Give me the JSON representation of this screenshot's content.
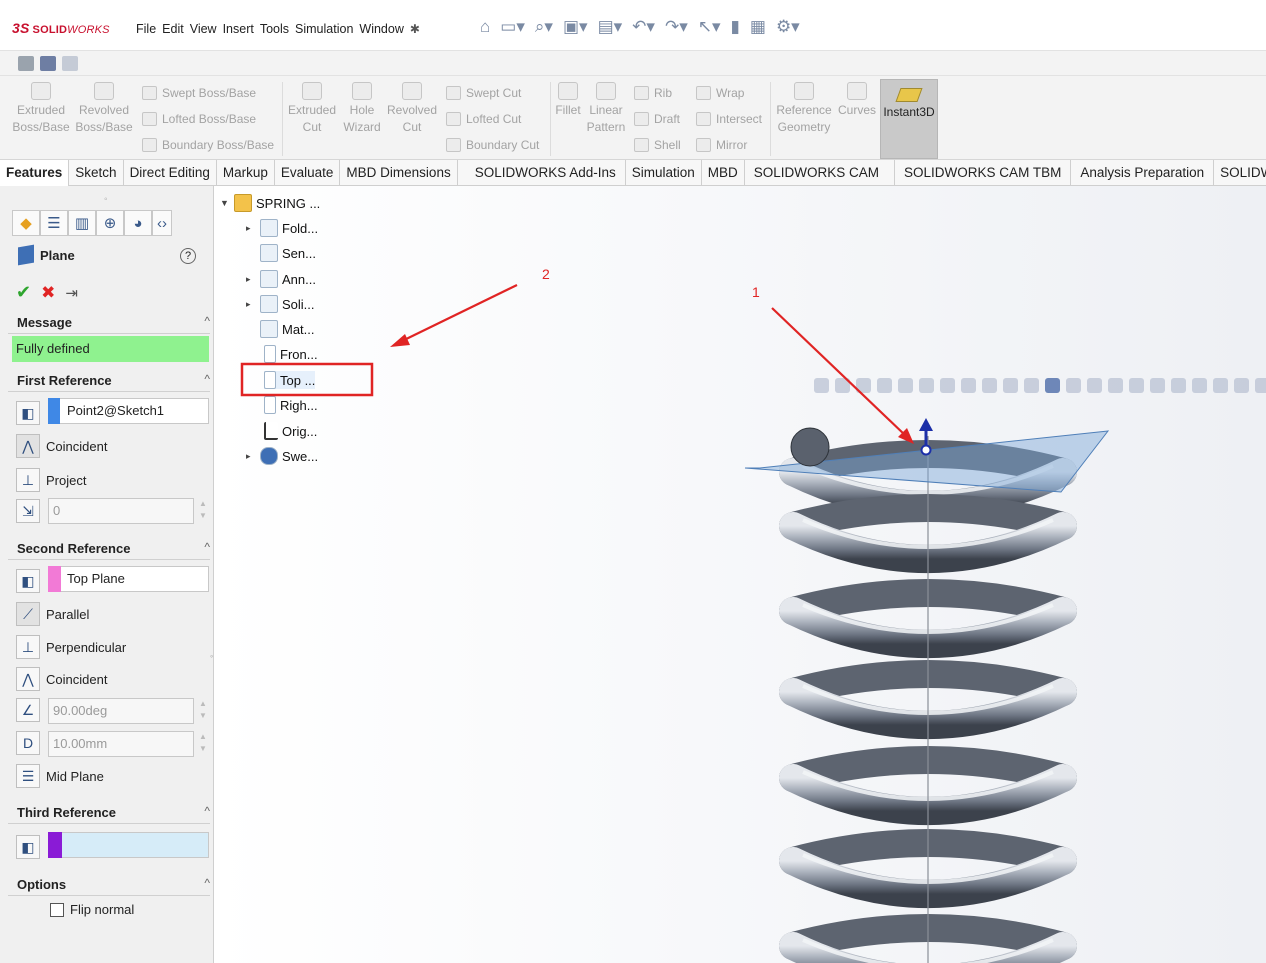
{
  "app": {
    "logo_prefix": "3S",
    "logo_solid": "SOLID",
    "logo_works": "WORKS",
    "menu": [
      "File",
      "Edit",
      "View",
      "Insert",
      "Tools",
      "Simulation",
      "Window"
    ],
    "pin_glyph": "✱"
  },
  "ribbon": {
    "extruded_boss": "Extruded Boss/Base",
    "revolved_boss": "Revolved Boss/Base",
    "swept_boss": "Swept Boss/Base",
    "lofted_boss": "Lofted Boss/Base",
    "boundary_boss": "Boundary Boss/Base",
    "extruded_cut": "Extruded Cut",
    "hole_wizard": "Hole Wizard",
    "revolved_cut": "Revolved Cut",
    "swept_cut": "Swept Cut",
    "lofted_cut": "Lofted Cut",
    "boundary_cut": "Boundary Cut",
    "fillet": "Fillet",
    "linear_pattern": "Linear Pattern",
    "rib": "Rib",
    "wrap": "Wrap",
    "draft": "Draft",
    "intersect": "Intersect",
    "shell": "Shell",
    "mirror": "Mirror",
    "reference_geometry": "Reference Geometry",
    "curves": "Curves",
    "instant3d": "Instant3D"
  },
  "tabs": [
    "Features",
    "Sketch",
    "Direct Editing",
    "Markup",
    "Evaluate",
    "MBD Dimensions",
    "SOLIDWORKS Add-Ins",
    "Simulation",
    "MBD",
    "SOLIDWORKS CAM",
    "SOLIDWORKS CAM TBM",
    "Analysis Preparation",
    "SOLIDW"
  ],
  "pm": {
    "title": "Plane",
    "help_glyph": "?",
    "ok_glyph": "✔",
    "cancel_glyph": "✖",
    "pin_glyph": "⇥",
    "message_head": "Message",
    "message_text": "Fully defined",
    "first_ref_head": "First Reference",
    "first_ref_value": "Point2@Sketch1",
    "coincident": "Coincident",
    "project": "Project",
    "first_value": "0",
    "second_ref_head": "Second Reference",
    "second_ref_value": "Top Plane",
    "parallel": "Parallel",
    "perpendicular": "Perpendicular",
    "coincident2": "Coincident",
    "angle_value": "90.00deg",
    "distance_value": "10.00mm",
    "mid_plane": "Mid Plane",
    "third_ref_head": "Third Reference",
    "options_head": "Options",
    "flip_normal": "Flip normal",
    "collapse_glyph": "^",
    "accent_blue": "#3f88e6",
    "accent_purple": "#8a1bd6",
    "message_green": "#8ff28f"
  },
  "tree": {
    "root": "SPRING ...",
    "items": [
      "Fold...",
      "Sen...",
      "Ann...",
      "Soli...",
      "Mat...",
      "Fron...",
      "Top ...",
      "Righ...",
      "Orig...",
      "Swe..."
    ]
  },
  "annotations": {
    "label_1": "1",
    "label_2": "2",
    "color": "#e02424"
  },
  "model": {
    "spring_color": "#7c8595",
    "plane_color": "#7aa7d8"
  }
}
